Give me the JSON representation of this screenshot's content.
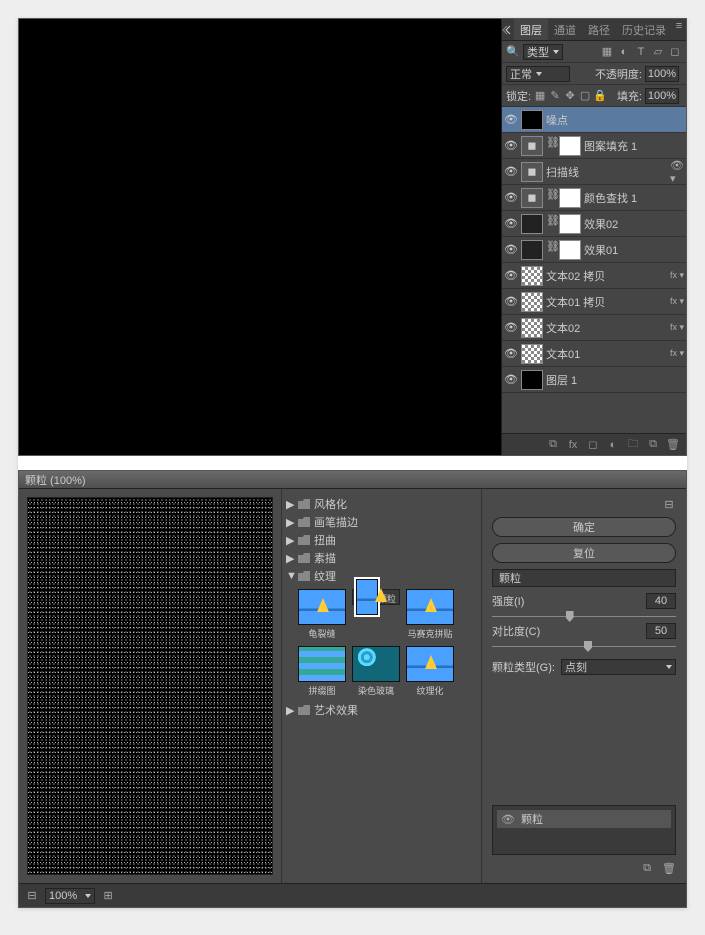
{
  "panel": {
    "tabs": [
      "图层",
      "通道",
      "路径",
      "历史记录"
    ],
    "filter_label": "类型",
    "blend_mode": "正常",
    "opacity_label": "不透明度:",
    "opacity_value": "100%",
    "lock_label": "锁定:",
    "fill_label": "填充:",
    "fill_value": "100%",
    "layers": [
      {
        "name": "噪点",
        "selected": true,
        "thumb": "black",
        "mask": false,
        "fx": false
      },
      {
        "name": "图案填充 1",
        "thumb": "adj",
        "mask": true,
        "fx": false
      },
      {
        "name": "扫描线",
        "thumb": "adj",
        "mask": false,
        "fx": false,
        "eye_extra": true
      },
      {
        "name": "颜色查找 1",
        "thumb": "adj",
        "mask": true,
        "fx": false
      },
      {
        "name": "效果02",
        "thumb": "dark",
        "mask": true,
        "fx": false
      },
      {
        "name": "效果01",
        "thumb": "dark",
        "mask": true,
        "fx": false
      },
      {
        "name": "文本02 拷贝",
        "thumb": "checker",
        "mask": false,
        "fx": true
      },
      {
        "name": "文本01 拷贝",
        "thumb": "checker",
        "mask": false,
        "fx": true
      },
      {
        "name": "文本02",
        "thumb": "checker",
        "mask": false,
        "fx": true
      },
      {
        "name": "文本01",
        "thumb": "checker",
        "mask": false,
        "fx": true
      },
      {
        "name": "图层 1",
        "thumb": "black",
        "mask": false,
        "fx": false
      }
    ]
  },
  "filter": {
    "window_title": "颗粒 (100%)",
    "categories": [
      "风格化",
      "画笔描边",
      "扭曲",
      "素描",
      "纹理",
      "艺术效果"
    ],
    "open_category": "纹理",
    "thumbs": [
      {
        "name": "龟裂缝",
        "type": "img"
      },
      {
        "name": "颗粒",
        "type": "img",
        "selected": true
      },
      {
        "name": "马赛克拼贴",
        "type": "img"
      },
      {
        "name": "拼缀图",
        "type": "pat"
      },
      {
        "name": "染色玻璃",
        "type": "glass"
      },
      {
        "name": "纹理化",
        "type": "img"
      }
    ],
    "ok": "确定",
    "reset": "复位",
    "effect_name": "颗粒",
    "params": [
      {
        "label": "强度(I)",
        "value": "40",
        "pos": 40
      },
      {
        "label": "对比度(C)",
        "value": "50",
        "pos": 50
      }
    ],
    "type_label": "颗粒类型(G):",
    "type_value": "点刻",
    "applied_layer": "颗粒",
    "zoom": "100%"
  }
}
